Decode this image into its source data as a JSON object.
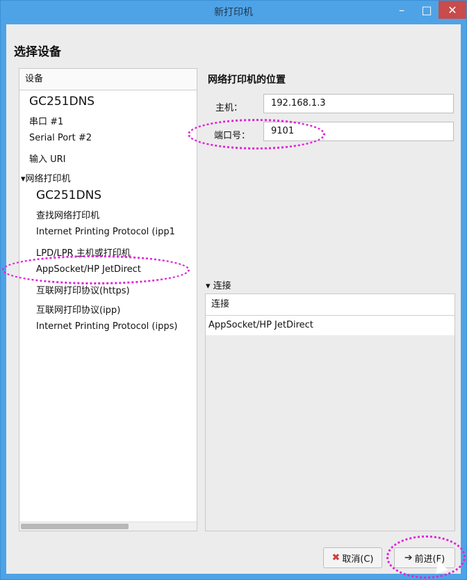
{
  "window": {
    "title": "新打印机",
    "min_glyph": "–",
    "max_glyph": "□",
    "close_glyph": "✕"
  },
  "heading": "选择设备",
  "device_list": {
    "header": "设备",
    "items": [
      "GC251DNS",
      "串口 #1",
      "Serial Port #2",
      "输入 URI",
      "网络打印机",
      "GC251DNS",
      "查找网络打印机",
      "Internet Printing Protocol (ipp1",
      "LPD/LPR 主机或打印机",
      "AppSocket/HP JetDirect",
      "互联网打印协议(https)",
      "互联网打印协议(ipp)",
      "Internet Printing Protocol (ipps)"
    ],
    "expander_glyph": "▾"
  },
  "location": {
    "title": "网络打印机的位置",
    "host_label": "主机：",
    "host_value": "192.168.1.3",
    "port_label": "端口号：",
    "port_value": "9101"
  },
  "connection": {
    "expander_label": "连接",
    "expander_glyph": "▾",
    "table_header": "连接",
    "rows": [
      "AppSocket/HP JetDirect"
    ]
  },
  "buttons": {
    "cancel_icon": "✖",
    "cancel_label": "取消(C)",
    "next_icon": "➔",
    "next_label": "前进(F)"
  },
  "colors": {
    "titlebar": "#4ea3e6",
    "close": "#c94b4b",
    "annotation": "#e024d8"
  }
}
